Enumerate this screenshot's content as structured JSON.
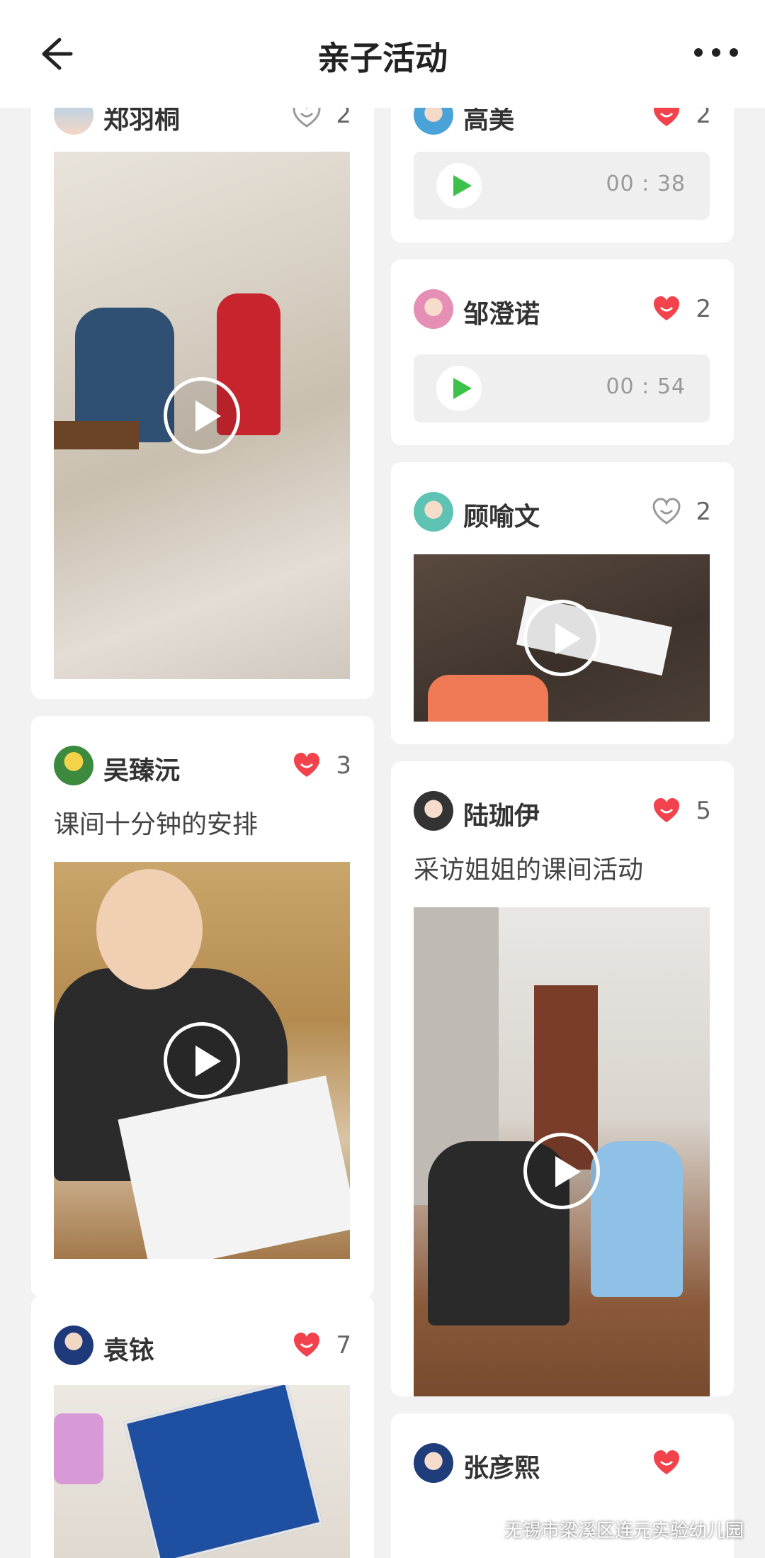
{
  "header": {
    "title": "亲子活动",
    "back_icon": "arrow-left-icon",
    "more_icon": "more-horizontal-icon"
  },
  "colors": {
    "like_active": "#f2424c",
    "like_inactive": "#999999",
    "audio_play": "#3cc24a"
  },
  "left_column": [
    {
      "author": "郑羽桐",
      "liked": false,
      "likes": "2",
      "caption": "",
      "media": "video"
    },
    {
      "author": "吴臻沅",
      "liked": true,
      "likes": "3",
      "caption": "课间十分钟的安排",
      "media": "video"
    },
    {
      "author": "袁铱",
      "liked": true,
      "likes": "7",
      "caption": "",
      "media": "video"
    }
  ],
  "right_column": [
    {
      "author": "高美",
      "liked": true,
      "likes": "2",
      "media": "audio",
      "duration": "00 : 38"
    },
    {
      "author": "邹澄诺",
      "liked": true,
      "likes": "2",
      "media": "audio",
      "duration": "00 : 54"
    },
    {
      "author": "顾喻文",
      "liked": false,
      "likes": "2",
      "caption": "",
      "media": "video"
    },
    {
      "author": "陆珈伊",
      "liked": true,
      "likes": "5",
      "caption": "采访姐姐的课间活动",
      "media": "video"
    },
    {
      "author": "张彦熙",
      "liked": true,
      "likes": "",
      "caption": "",
      "media": ""
    }
  ],
  "watermark": "无锡市梁溪区连元实验幼儿园"
}
